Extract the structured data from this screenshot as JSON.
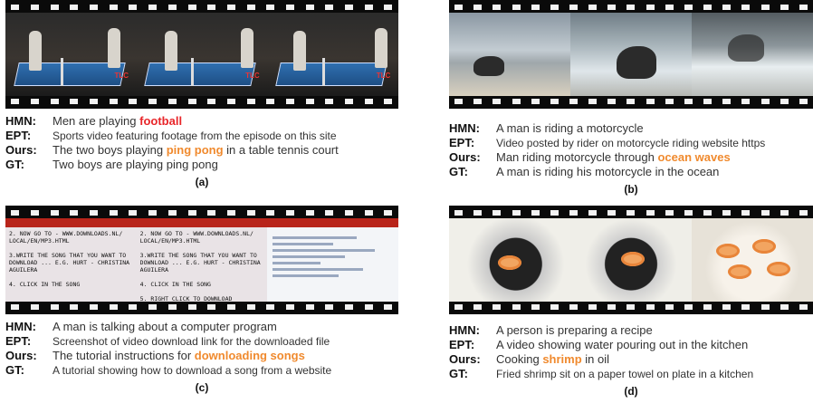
{
  "panels": {
    "a": {
      "label": "(a)",
      "hmn_key": "HMN:",
      "hmn_pre": "Men are playing ",
      "hmn_hl": "football",
      "hmn_post": "",
      "ept_key": "EPT:",
      "ept": "Sports video featuring footage from the episode on this site",
      "ours_key": "Ours:",
      "ours_pre": "The two boys playing ",
      "ours_hl": "ping pong",
      "ours_post": " in a table tennis court",
      "gt_key": "GT:",
      "gt": "Two boys are playing ping pong",
      "frame_logo": "TLC"
    },
    "b": {
      "label": "(b)",
      "hmn_key": "HMN:",
      "hmn": "A man is riding a motorcycle",
      "ept_key": "EPT:",
      "ept": "Video posted by rider on motorcycle riding website https",
      "ours_key": "Ours:",
      "ours_pre": "Man riding motorcycle through ",
      "ours_hl": "ocean waves",
      "ours_post": "",
      "gt_key": "GT:",
      "gt": "A man is riding his motorcycle in the ocean"
    },
    "c": {
      "label": "(c)",
      "hmn_key": "HMN:",
      "hmn": "A man is talking about a computer program",
      "ept_key": "EPT:",
      "ept": "Screenshot of video download link for the downloaded file",
      "ours_key": "Ours:",
      "ours_pre": "The tutorial instructions for ",
      "ours_hl": "downloading songs",
      "ours_post": "",
      "gt_key": "GT:",
      "gt": "A tutorial showing how to download a song from a website",
      "frame1_text": "2. NOW GO TO - WWW.DOWNLOADS.NL/\nLOCAL/EN/MP3.HTML\n\n3.WRITE THE SONG THAT YOU WANT TO\nDOWNLOAD ... E.G. HURT - CHRISTINA\nAGUILERA\n\n4. CLICK IN THE SONG",
      "frame2_text": "2. NOW GO TO - WWW.DOWNLOADS.NL/\nLOCAL/EN/MP3.HTML\n\n3.WRITE THE SONG THAT YOU WANT TO\nDOWNLOAD ... E.G. HURT - CHRISTINA\nAGUILERA\n\n4. CLICK IN THE SONG\n\n5. RIGHT CLICK TO DOWNLOAD"
    },
    "d": {
      "label": "(d)",
      "hmn_key": "HMN:",
      "hmn": "A person is preparing a recipe",
      "ept_key": "EPT:",
      "ept": "A video showing water pouring out in the kitchen",
      "ours_key": "Ours:",
      "ours_pre": "Cooking ",
      "ours_hl": "shrimp",
      "ours_post": " in oil",
      "gt_key": "GT:",
      "gt": "Fried shrimp sit on a paper towel on plate in a kitchen"
    }
  },
  "colors": {
    "highlight_wrong": "#e8262a",
    "highlight_key": "#f08a2e"
  }
}
